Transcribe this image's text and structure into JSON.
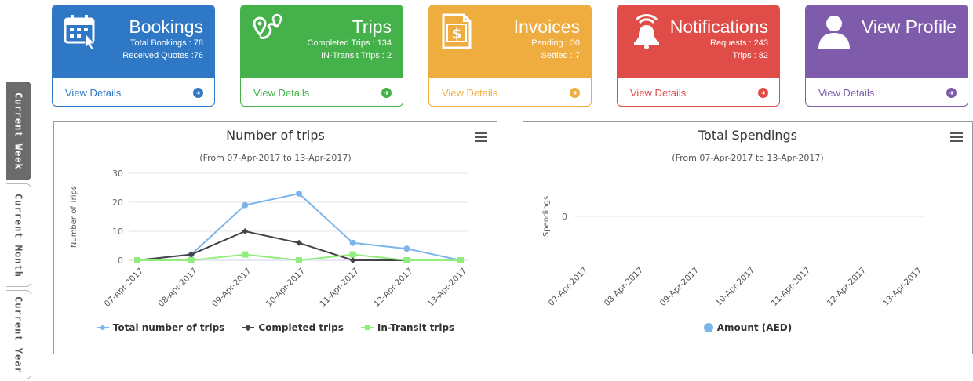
{
  "side_tabs": [
    "Current Week",
    "Current Month",
    "Current Year"
  ],
  "cards": [
    {
      "title": "Bookings",
      "lines": [
        "Total Bookings : 78",
        "Received Quotes :76"
      ],
      "link": "View Details",
      "color": "#2f78c6",
      "icon": "calendar-icon"
    },
    {
      "title": "Trips",
      "lines": [
        "Completed Trips : 134",
        "IN-Transit Trips : 2"
      ],
      "link": "View Details",
      "color": "#45b14a",
      "icon": "route-icon"
    },
    {
      "title": "Invoices",
      "lines": [
        "Pending : 30",
        "Settled : 7"
      ],
      "link": "View Details",
      "color": "#f0ad3f",
      "icon": "invoice-icon"
    },
    {
      "title": "Notifications",
      "lines": [
        "Requests : 243",
        "Trips : 82"
      ],
      "link": "View Details",
      "color": "#e04c48",
      "icon": "bell-icon"
    },
    {
      "title": "View Profile",
      "lines": [],
      "link": "View Details",
      "color": "#7f5bab",
      "icon": "user-icon"
    }
  ],
  "chart_data": [
    {
      "type": "line",
      "title": "Number of trips",
      "subtitle": "(From 07-Apr-2017 to 13-Apr-2017)",
      "ylabel": "Number of Trips",
      "ylim": [
        0,
        30
      ],
      "yticks": [
        0,
        10,
        20,
        30
      ],
      "categories": [
        "07-Apr-2017",
        "08-Apr-2017",
        "09-Apr-2017",
        "10-Apr-2017",
        "11-Apr-2017",
        "12-Apr-2017",
        "13-Apr-2017"
      ],
      "series": [
        {
          "name": "Total number of trips",
          "values": [
            0,
            2,
            19,
            23,
            6,
            4,
            0
          ],
          "color": "#7cb5ec",
          "marker": "circle"
        },
        {
          "name": "Completed trips",
          "values": [
            0,
            2,
            10,
            6,
            0,
            0,
            0
          ],
          "color": "#434348",
          "marker": "diamond"
        },
        {
          "name": "In-Transit trips",
          "values": [
            0,
            0,
            2,
            0,
            2,
            0,
            0
          ],
          "color": "#90ed7d",
          "marker": "square"
        }
      ],
      "grid": true,
      "legend": "bottom"
    },
    {
      "type": "line",
      "title": "Total Spendings",
      "subtitle": "(From 07-Apr-2017 to 13-Apr-2017)",
      "ylabel": "Spendings",
      "yticks": [
        0
      ],
      "categories": [
        "07-Apr-2017",
        "08-Apr-2017",
        "09-Apr-2017",
        "10-Apr-2017",
        "11-Apr-2017",
        "12-Apr-2017",
        "13-Apr-2017"
      ],
      "series": [
        {
          "name": "Amount (AED)",
          "values": [],
          "color": "#7cb5ec",
          "marker": "circle"
        }
      ],
      "grid": true,
      "legend": "bottom"
    }
  ]
}
